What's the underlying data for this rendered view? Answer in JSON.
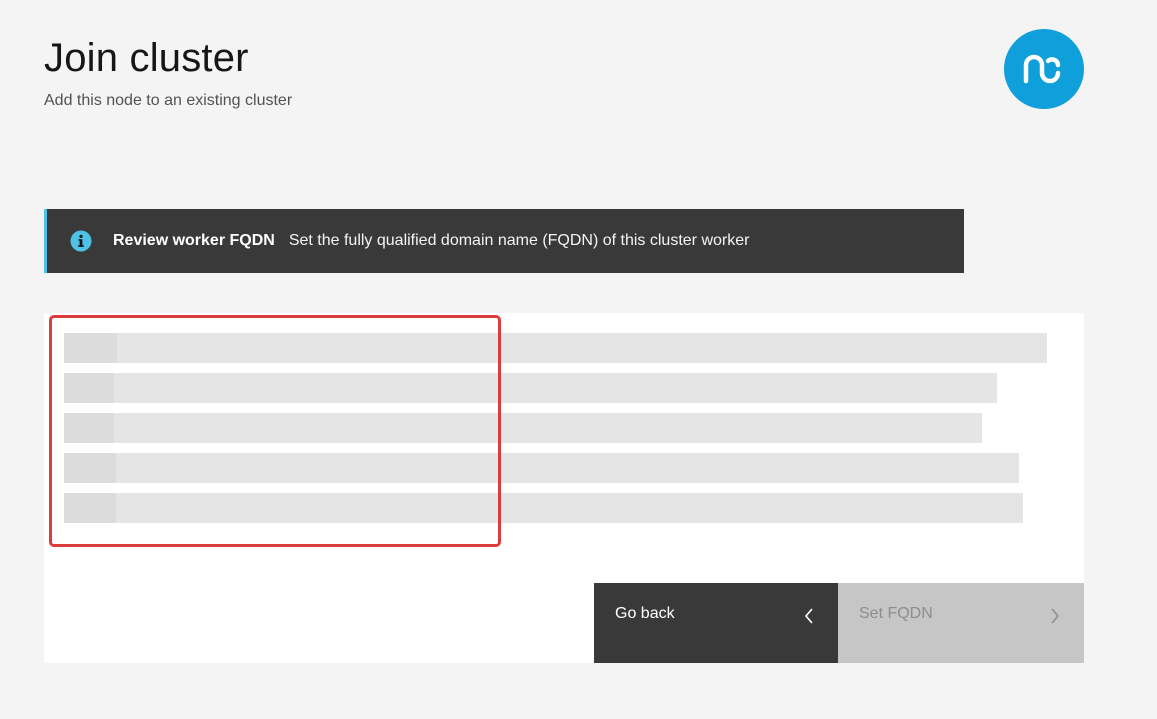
{
  "header": {
    "title": "Join cluster",
    "subtitle": "Add this node to an existing cluster"
  },
  "logo": {
    "icon": "ns-logo-icon",
    "color": "#0f9fdb"
  },
  "notification": {
    "icon": "info-icon",
    "title": "Review worker FQDN",
    "message": "Set the fully qualified domain name (FQDN) of this cluster worker",
    "accent": "#4ec1e6"
  },
  "skeleton": {
    "rows": 5,
    "highlight_color": "#da3d3a"
  },
  "actions": {
    "back_label": "Go back",
    "next_label": "Set FQDN",
    "next_disabled": true
  }
}
